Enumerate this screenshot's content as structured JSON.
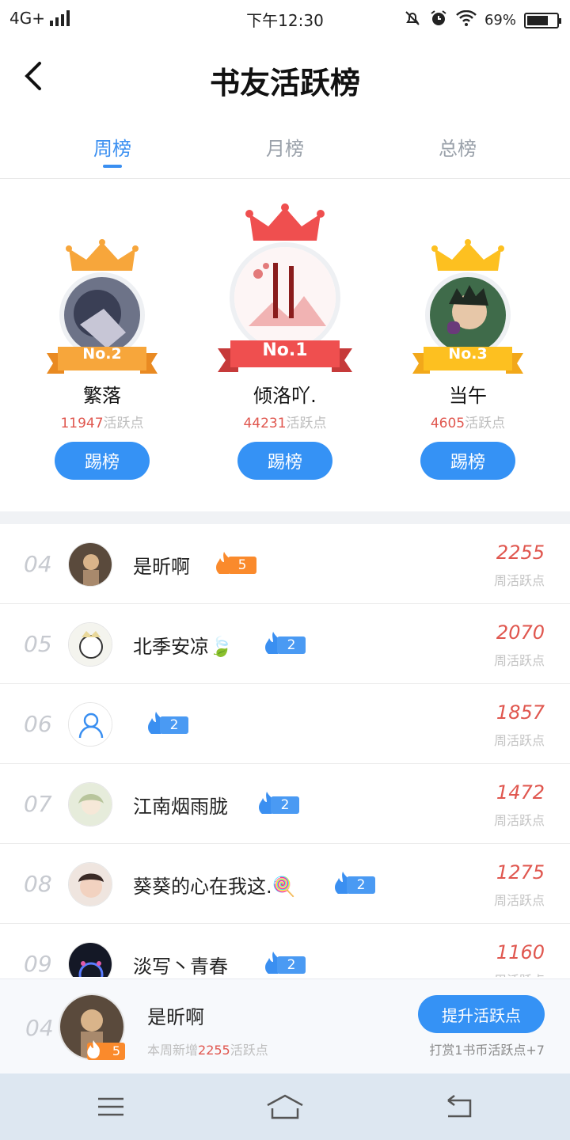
{
  "status": {
    "network": "4G+",
    "time": "下午12:30",
    "battery": "69%"
  },
  "header": {
    "title": "书友活跃榜"
  },
  "tabs": [
    {
      "label": "周榜",
      "active": true
    },
    {
      "label": "月榜",
      "active": false
    },
    {
      "label": "总榜",
      "active": false
    }
  ],
  "podium": [
    {
      "rank_label": "No.2",
      "name": "繁落",
      "score": "11947",
      "unit": "活跃点",
      "button": "踢榜"
    },
    {
      "rank_label": "No.1",
      "name": "倾洛吖.",
      "score": "44231",
      "unit": "活跃点",
      "button": "踢榜"
    },
    {
      "rank_label": "No.3",
      "name": "当午",
      "score": "4605",
      "unit": "活跃点",
      "button": "踢榜"
    }
  ],
  "list": [
    {
      "rank": "04",
      "name": "是昕啊",
      "level": "5",
      "score": "2255",
      "unit": "周活跃点"
    },
    {
      "rank": "05",
      "name": "北季安凉🍃",
      "level": "2",
      "score": "2070",
      "unit": "周活跃点"
    },
    {
      "rank": "06",
      "name": "",
      "level": "2",
      "score": "1857",
      "unit": "周活跃点"
    },
    {
      "rank": "07",
      "name": "江南烟雨胧",
      "level": "2",
      "score": "1472",
      "unit": "周活跃点"
    },
    {
      "rank": "08",
      "name": "葵葵的心在我这.🍭",
      "level": "2",
      "score": "1275",
      "unit": "周活跃点"
    },
    {
      "rank": "09",
      "name": "淡写丶青春",
      "level": "2",
      "score": "1160",
      "unit": "周活跃点"
    }
  ],
  "mine": {
    "rank": "04",
    "name": "是昕啊",
    "level": "5",
    "note_prefix": "本周新增",
    "note_value": "2255",
    "note_suffix": "活跃点",
    "boost": "提升活跃点",
    "tip": "打赏1书币活跃点+7"
  },
  "colors": {
    "accent": "#3592f5",
    "score": "#e0574f",
    "gold": "#fdc020",
    "silver": "#f7a63b",
    "first": "#ef4f4f"
  }
}
